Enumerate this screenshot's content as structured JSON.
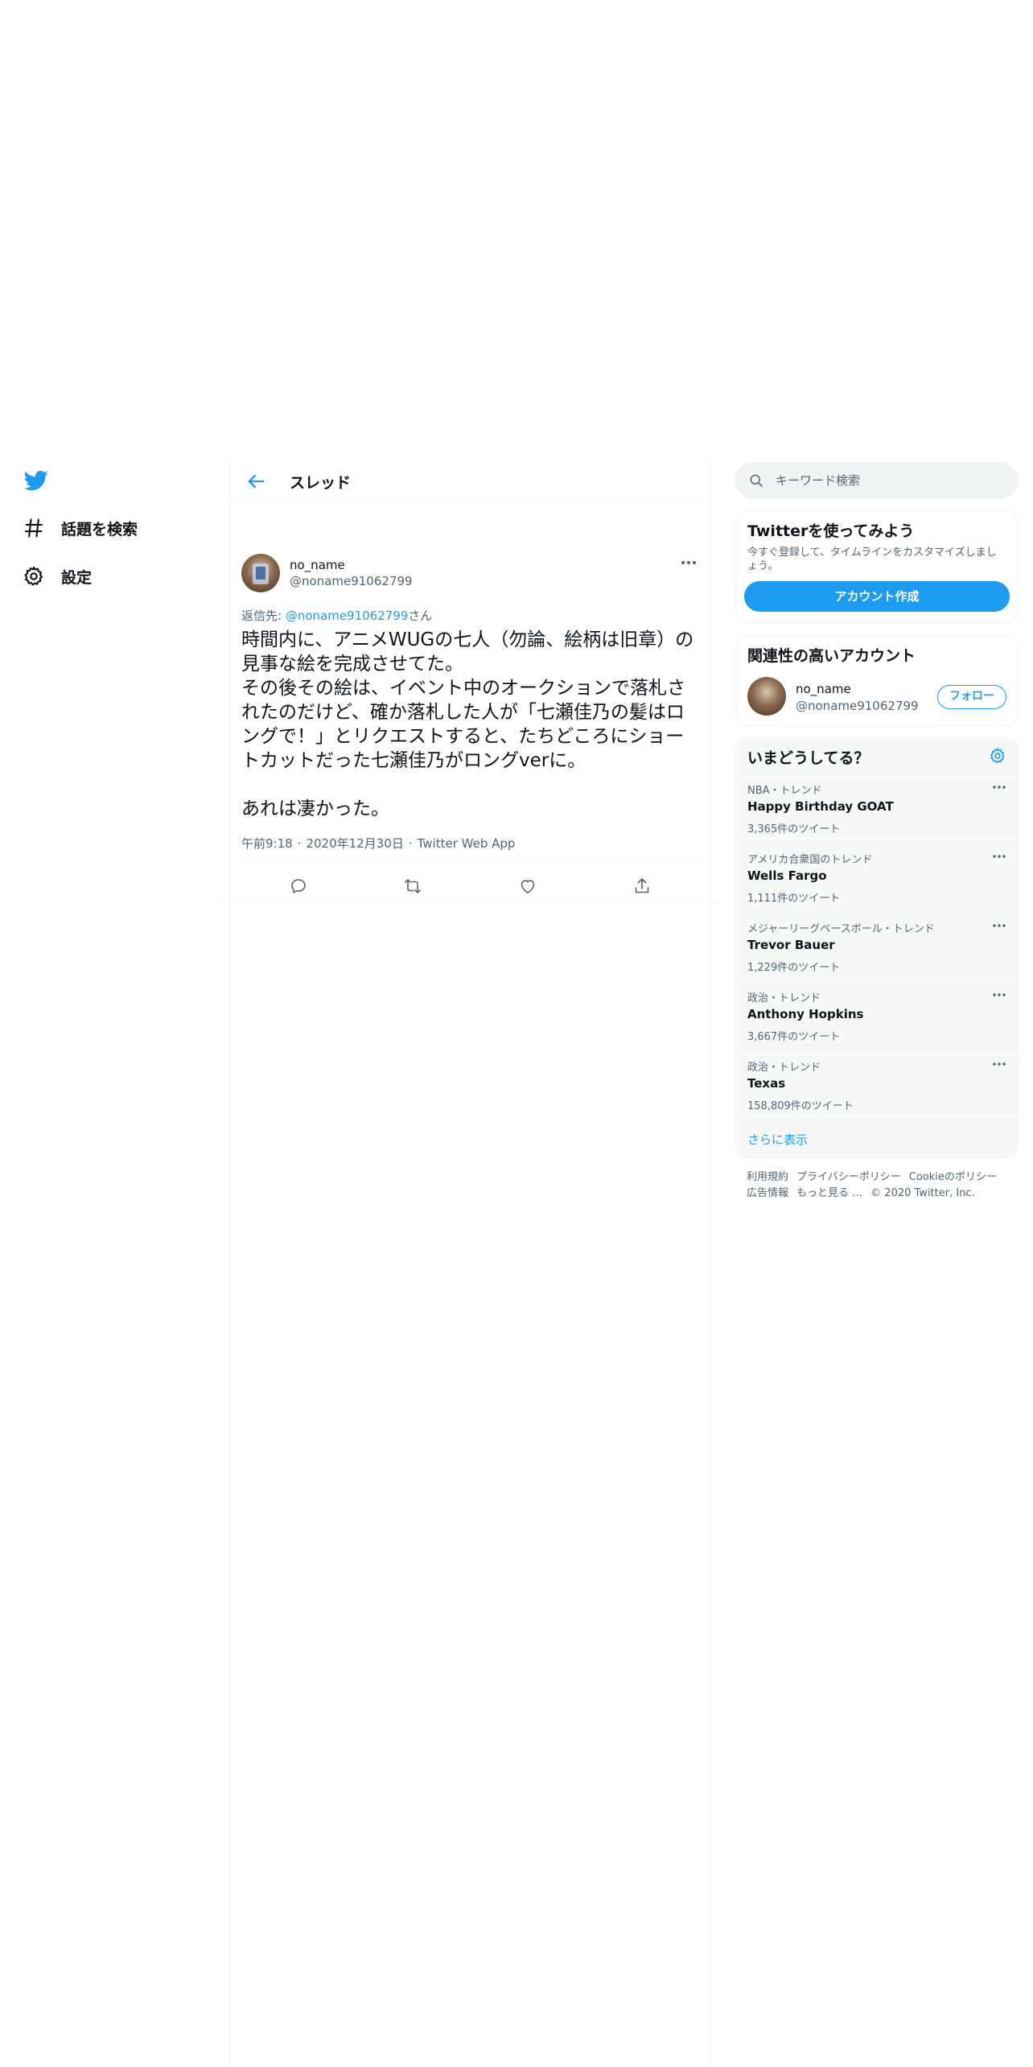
{
  "nav": {
    "explore_label": "話題を検索",
    "settings_label": "設定"
  },
  "header": {
    "title": "スレッド"
  },
  "tweet": {
    "display_name": "no_name",
    "handle": "@noname91062799",
    "reply_prefix": "返信先: ",
    "reply_handle": "@noname91062799",
    "reply_suffix": "さん",
    "text": "時間内に、アニメWUGの七人（勿論、絵柄は旧章）の見事な絵を完成させてた。\nその後その絵は、イベント中のオークションで落札されたのだけど、確か落札した人が「七瀬佳乃の髪はロングで！」とリクエストすると、たちどころにショートカットだった七瀬佳乃がロングverに。\n\nあれは凄かった。",
    "time": "午前9:18",
    "date": "2020年12月30日",
    "source": "Twitter Web App"
  },
  "search": {
    "placeholder": "キーワード検索"
  },
  "signup": {
    "title": "Twitterを使ってみよう",
    "description": "今すぐ登録して、タイムラインをカスタマイズしましょう。",
    "button": "アカウント作成"
  },
  "relevant": {
    "title": "関連性の高いアカウント",
    "name": "no_name",
    "handle": "@noname91062799",
    "follow": "フォロー"
  },
  "trends": {
    "title": "いまどうしてる？",
    "items": [
      {
        "context": "NBA・トレンド",
        "name": "Happy Birthday GOAT",
        "count": "3,365件のツイート"
      },
      {
        "context": "アメリカ合衆国のトレンド",
        "name": "Wells Fargo",
        "count": "1,111件のツイート"
      },
      {
        "context": "メジャーリーグベースボール・トレンド",
        "name": "Trevor Bauer",
        "count": "1,229件のツイート"
      },
      {
        "context": "政治・トレンド",
        "name": "Anthony Hopkins",
        "count": "3,667件のツイート"
      },
      {
        "context": "政治・トレンド",
        "name": "Texas",
        "count": "158,809件のツイート"
      }
    ],
    "show_more": "さらに表示"
  },
  "footer": {
    "terms": "利用規約",
    "privacy": "プライバシーポリシー",
    "cookie": "Cookieのポリシー",
    "ads": "広告情報",
    "more": "もっと見る",
    "copyright": "© 2020 Twitter, Inc."
  },
  "colors": {
    "accent": "#1d9bf0",
    "text": "#0f1419",
    "muted": "#536471",
    "divider": "#eff3f4"
  }
}
